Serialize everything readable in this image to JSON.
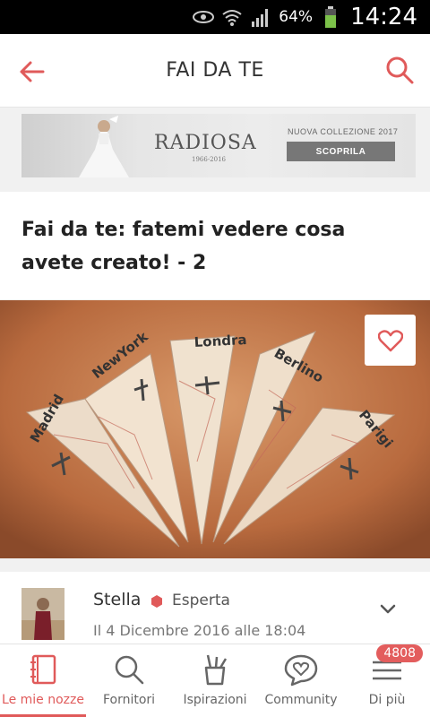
{
  "status_bar": {
    "battery_pct": "64%",
    "clock": "14:24",
    "icons": [
      "eye-icon",
      "wifi-icon",
      "signal-icon",
      "battery-icon"
    ]
  },
  "header": {
    "title": "FAI DA TE",
    "back_icon": "back-arrow-icon",
    "search_icon": "search-icon",
    "accent_color": "#e05a5a"
  },
  "banner": {
    "brand": "RADIOSA",
    "brand_years": "1966-2016",
    "collection": "NUOVA COLLEZIONE 2017",
    "cta": "SCOPRILA"
  },
  "post": {
    "title": "Fai da te: fatemi vedere cosa avete creato! - 2",
    "cone_labels": [
      "Madrid",
      "NewYork",
      "Londra",
      "Berlino",
      "Parigi"
    ]
  },
  "author": {
    "name": "Stella",
    "badge": "Esperta",
    "date": "Il 4 Dicembre 2016 alle 18:04"
  },
  "bottom_nav": {
    "items": [
      {
        "label": "Le mie nozze",
        "icon": "notebook-icon",
        "active": true
      },
      {
        "label": "Fornitori",
        "icon": "search-icon",
        "active": false
      },
      {
        "label": "Ispirazioni",
        "icon": "pencil-cup-icon",
        "active": false
      },
      {
        "label": "Community",
        "icon": "chat-heart-icon",
        "active": false
      },
      {
        "label": "Di più",
        "icon": "menu-icon",
        "active": false
      }
    ],
    "badge": "4808"
  }
}
